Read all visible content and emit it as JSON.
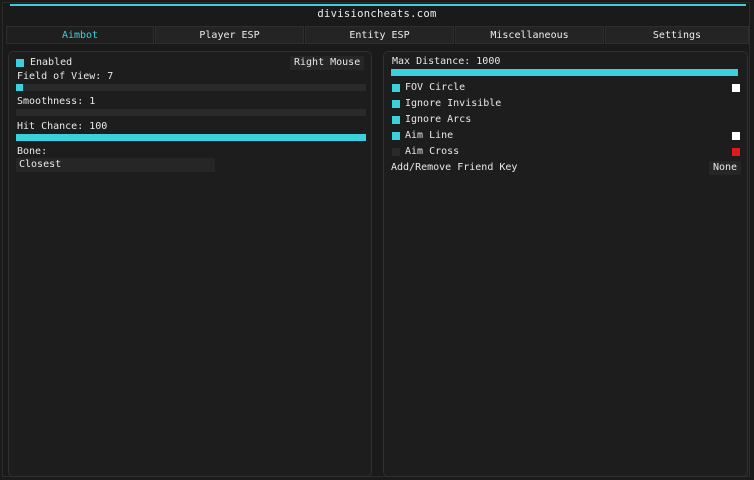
{
  "title": "divisioncheats.com",
  "tabs": [
    {
      "label": "Aimbot",
      "active": true
    },
    {
      "label": "Player ESP",
      "active": false
    },
    {
      "label": "Entity ESP",
      "active": false
    },
    {
      "label": "Miscellaneous",
      "active": false
    },
    {
      "label": "Settings",
      "active": false
    }
  ],
  "colors": {
    "accent": "#3cd0dc",
    "background": "#1a1a1a",
    "panel": "#1d1d1d",
    "swatch_white": "#ffffff",
    "swatch_red": "#e01818"
  },
  "left": {
    "enabled": {
      "label": "Enabled",
      "checked": true
    },
    "aim_key": "Right Mouse",
    "fov": {
      "label": "Field of View: 7",
      "value": 7,
      "fraction": 0.02
    },
    "smoothness": {
      "label": "Smoothness: 1",
      "value": 1,
      "fraction": 0.0
    },
    "hit_chance": {
      "label": "Hit Chance: 100",
      "value": 100,
      "fraction": 1.0
    },
    "bone": {
      "label": "Bone:",
      "selected": "Closest"
    }
  },
  "right": {
    "max_distance": {
      "label": "Max Distance: 1000",
      "value": 1000,
      "fraction": 1.0
    },
    "fov_circle": {
      "label": "FOV Circle",
      "checked": true,
      "color": "#ffffff"
    },
    "ignore_invisible": {
      "label": "Ignore Invisible",
      "checked": true
    },
    "ignore_arcs": {
      "label": "Ignore Arcs",
      "checked": true
    },
    "aim_line": {
      "label": "Aim Line",
      "checked": true,
      "color": "#ffffff"
    },
    "aim_cross": {
      "label": "Aim Cross",
      "checked": false,
      "color": "#e01818"
    },
    "friend_key": {
      "label": "Add/Remove Friend Key",
      "value": "None"
    }
  }
}
